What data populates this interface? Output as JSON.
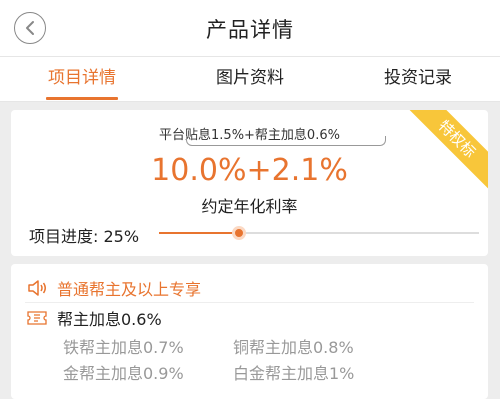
{
  "header": {
    "title": "产品详情"
  },
  "tabs": [
    {
      "label": "项目详情",
      "active": true
    },
    {
      "label": "图片资料",
      "active": false
    },
    {
      "label": "投资记录",
      "active": false
    }
  ],
  "rate_card": {
    "ribbon": "特权标",
    "sub_rate": "平台贴息1.5%+帮主加息0.6%",
    "main_rate": "10.0%+2.1%",
    "rate_label": "约定年化利率",
    "progress_label": "项目进度: 25%",
    "progress": 0.25
  },
  "member_card": {
    "title": "普通帮主及以上专享",
    "bonus": "帮主加息0.6%",
    "tiers": [
      "铁帮主加息0.7%",
      "铜帮主加息0.8%",
      "金帮主加息0.9%",
      "白金帮主加息1%"
    ]
  },
  "colors": {
    "accent": "#e8742f",
    "ribbon": "#f8c63a"
  },
  "icons": [
    "back-icon",
    "speaker-icon",
    "ticket-icon"
  ]
}
